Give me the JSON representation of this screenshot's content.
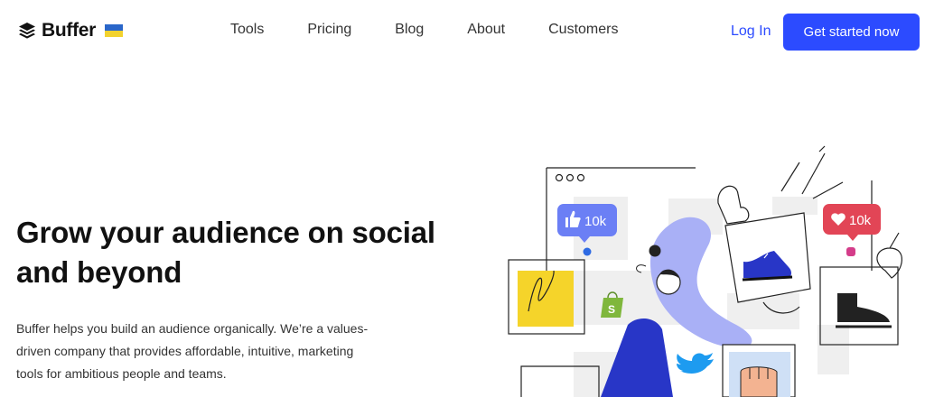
{
  "nav": {
    "logo_text": "Buffer",
    "links": [
      "Tools",
      "Pricing",
      "Blog",
      "About",
      "Customers"
    ],
    "login_label": "Log In",
    "cta_label": "Get started now"
  },
  "hero": {
    "title": "Grow your audience on social and beyond",
    "description": "Buffer helps you build an audience organically. We’re a values-driven company that provides affordable, intuitive, marketing tools for ambitious people and teams."
  },
  "illustration": {
    "facebook_badge": "10k",
    "instagram_badge": "10k"
  },
  "colors": {
    "accent": "#2c4bff",
    "facebook_badge": "#6b7ff5",
    "instagram_badge": "#e24556"
  }
}
